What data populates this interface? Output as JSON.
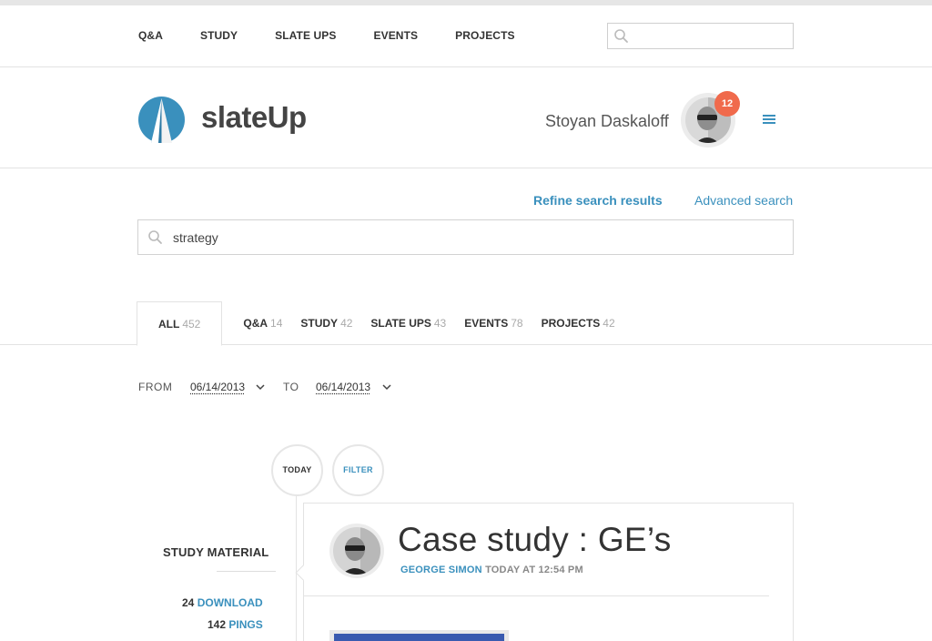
{
  "topnav": {
    "links": [
      "Q&A",
      "STUDY",
      "SLATE UPS",
      "EVENTS",
      "PROJECTS"
    ],
    "search_placeholder": ""
  },
  "header": {
    "brand": "slateUp",
    "username": "Stoyan Daskaloff",
    "notification_count": "12"
  },
  "search": {
    "refine_label": "Refine search results",
    "advanced_label": "Advanced search",
    "query": "strategy"
  },
  "tabs": [
    {
      "label": "ALL",
      "count": "452"
    },
    {
      "label": "Q&A",
      "count": "14"
    },
    {
      "label": "STUDY",
      "count": "42"
    },
    {
      "label": "SLATE UPS",
      "count": "43"
    },
    {
      "label": "EVENTS",
      "count": "78"
    },
    {
      "label": "PROJECTS",
      "count": "42"
    }
  ],
  "date_filter": {
    "from_label": "FROM",
    "from_value": "06/14/2013",
    "to_label": "TO",
    "to_value": "06/14/2013"
  },
  "timeline": {
    "today_label": "TODAY",
    "filter_label": "FILTER"
  },
  "category": {
    "title": "STUDY MATERIAL",
    "downloads_count": "24",
    "downloads_label": "DOWNLOAD",
    "pings_count": "142",
    "pings_label": "PINGS"
  },
  "post": {
    "title": "Case study : GE’s",
    "author": "GEORGE SIMON",
    "timestamp": "TODAY AT 12:54 PM"
  },
  "colors": {
    "accent": "#3a90bd",
    "badge": "#f06a4c"
  },
  "icons": [
    "search-icon",
    "logo-icon",
    "menu-icon",
    "chevron-down-icon"
  ]
}
